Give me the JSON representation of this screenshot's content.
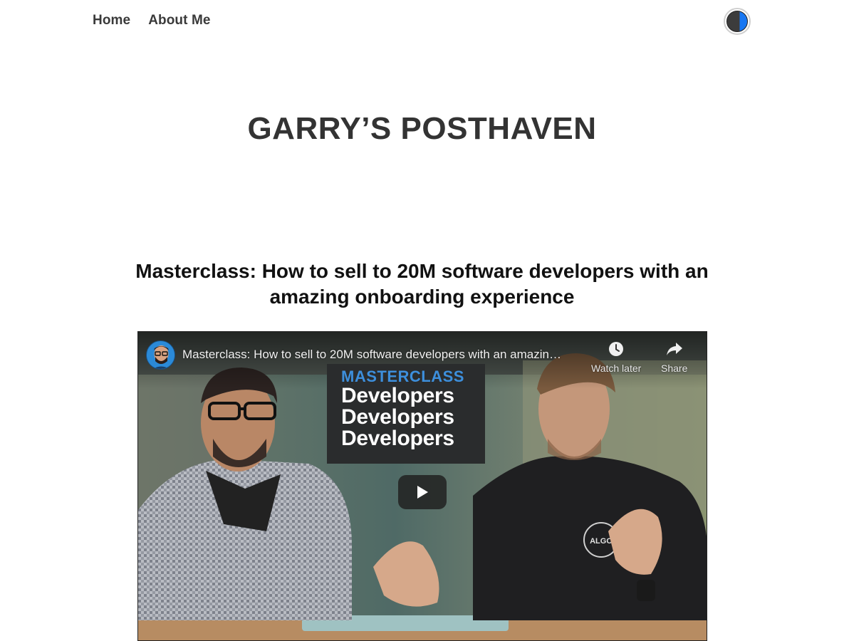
{
  "nav": {
    "home_label": "Home",
    "about_label": "About Me"
  },
  "theme_toggle": {
    "icon": "theme-toggle-icon",
    "dark_color": "#3c3c3c",
    "accent_color": "#1877f2"
  },
  "site": {
    "title": "GARRY’S POSTHAVEN"
  },
  "post": {
    "title": "Masterclass: How to sell to 20M software developers with an amazing onboarding experience"
  },
  "video": {
    "title": "Masterclass: How to sell to 20M software developers with an amazin…",
    "watch_later_label": "Watch later",
    "share_label": "Share",
    "card_heading": "MASTERCLASS",
    "card_lines": [
      "Developers",
      "Developers",
      "Developers"
    ],
    "shirt_text": "ALGO",
    "icons": {
      "watch_later": "clock-icon",
      "share": "share-arrow-icon",
      "play": "play-icon",
      "channel": "channel-avatar"
    }
  }
}
